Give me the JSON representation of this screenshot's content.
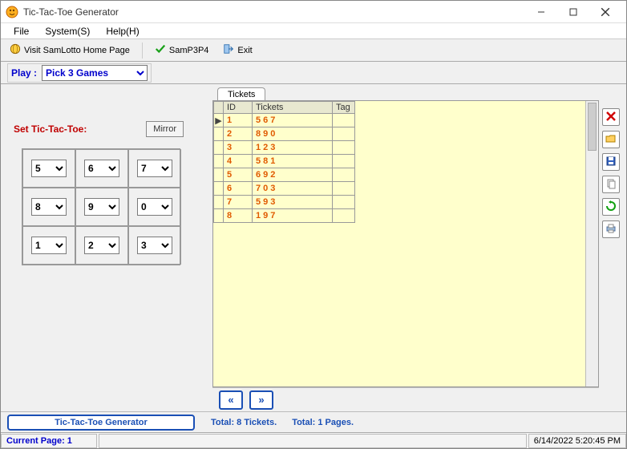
{
  "window": {
    "title": "Tic-Tac-Toe Generator"
  },
  "menu": {
    "file": "File",
    "system": "System(S)",
    "help": "Help(H)"
  },
  "toolbar": {
    "visit": "Visit SamLotto Home Page",
    "sam": "SamP3P4",
    "exit": "Exit"
  },
  "play": {
    "label": "Play :",
    "selected": "Pick 3 Games"
  },
  "left": {
    "set_label": "Set Tic-Tac-Toe:",
    "mirror": "Mirror",
    "cells": [
      "5",
      "6",
      "7",
      "8",
      "9",
      "0",
      "1",
      "2",
      "3"
    ]
  },
  "tabs": {
    "tickets": "Tickets"
  },
  "table": {
    "headers": {
      "id": "ID",
      "tickets": "Tickets",
      "tag": "Tag"
    },
    "rows": [
      {
        "id": "1",
        "tickets": "567"
      },
      {
        "id": "2",
        "tickets": "890"
      },
      {
        "id": "3",
        "tickets": "123"
      },
      {
        "id": "4",
        "tickets": "581"
      },
      {
        "id": "5",
        "tickets": "692"
      },
      {
        "id": "6",
        "tickets": "703"
      },
      {
        "id": "7",
        "tickets": "593"
      },
      {
        "id": "8",
        "tickets": "197"
      }
    ]
  },
  "pager": {
    "prev": "«",
    "next": "»"
  },
  "bottom": {
    "generator": "Tic-Tac-Toe Generator",
    "total_tickets": "Total: 8 Tickets.",
    "total_pages": "Total: 1 Pages."
  },
  "status": {
    "current_page": "Current Page: 1",
    "datetime": "6/14/2022 5:20:45 PM"
  },
  "icons": {
    "delete": "delete-icon",
    "open": "open-icon",
    "save": "save-icon",
    "copy": "copy-icon",
    "refresh": "refresh-icon",
    "print": "print-icon"
  }
}
